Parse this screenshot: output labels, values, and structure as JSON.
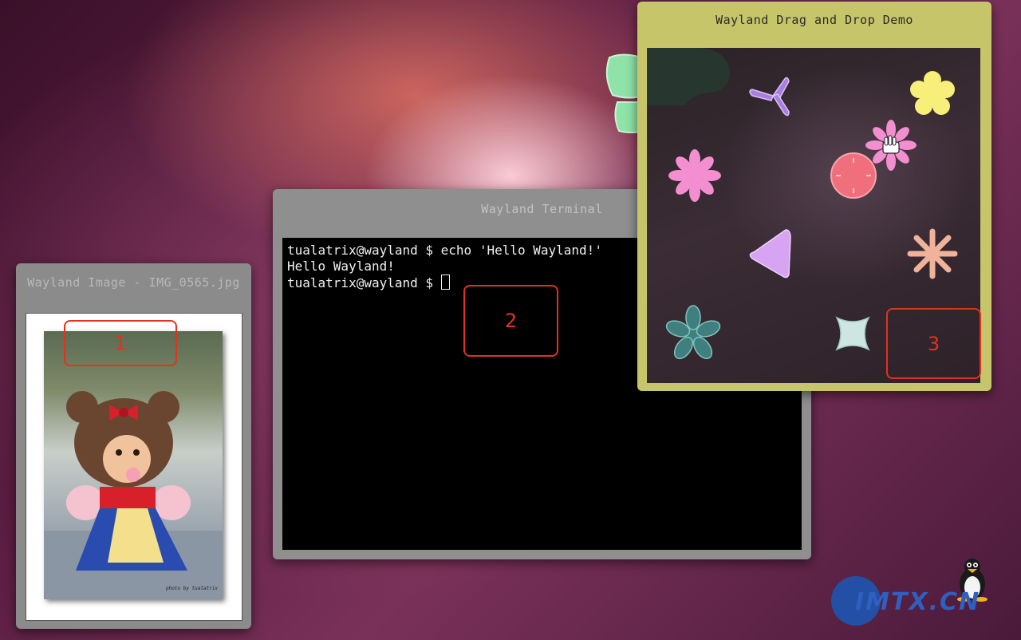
{
  "windows": {
    "image": {
      "title": "Wayland Image - IMG_0565.jpg",
      "photo_credit": "photo by tualatrix"
    },
    "terminal": {
      "title": "Wayland Terminal",
      "lines": [
        "tualatrix@wayland $ echo 'Hello Wayland!'",
        "Hello Wayland!"
      ],
      "prompt": "tualatrix@wayland $ "
    },
    "dnd": {
      "title": "Wayland Drag and Drop Demo"
    }
  },
  "annotations": {
    "one": "1",
    "two": "2",
    "three": "3"
  },
  "watermark": {
    "logo_text": "IMTX.CN"
  },
  "colors": {
    "annotation": "#e0321f",
    "dnd_frame": "#c7c56a",
    "window_frame": "#8f8f8f"
  }
}
